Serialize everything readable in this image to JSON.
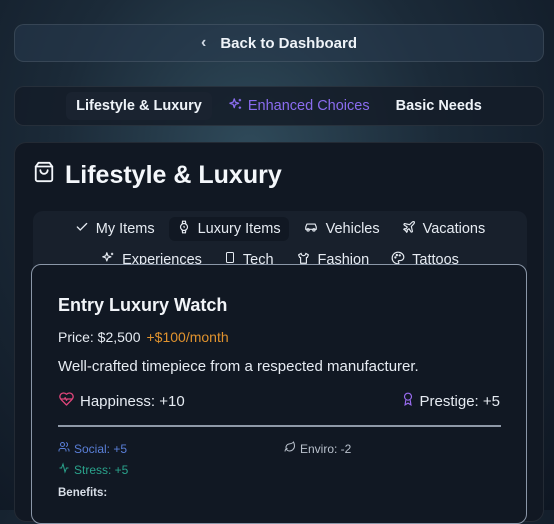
{
  "back_button": {
    "label": "Back to Dashboard"
  },
  "main_tabs": [
    {
      "label": "Lifestyle & Luxury",
      "active": true
    },
    {
      "label": "Enhanced Choices",
      "icon": "sparkles-icon",
      "accent": "#8a6cf0"
    },
    {
      "label": "Basic Needs"
    }
  ],
  "panel": {
    "title": "Lifestyle & Luxury",
    "icon": "shopping-bag-icon"
  },
  "subtabs_row1": [
    {
      "label": "My Items",
      "icon": "check-icon"
    },
    {
      "label": "Luxury Items",
      "icon": "watch-icon",
      "active": true
    },
    {
      "label": "Vehicles",
      "icon": "car-icon"
    },
    {
      "label": "Vacations",
      "icon": "plane-icon"
    }
  ],
  "subtabs_row2": [
    {
      "label": "Experiences",
      "icon": "sparkles-icon"
    },
    {
      "label": "Tech",
      "icon": "smartphone-icon"
    },
    {
      "label": "Fashion",
      "icon": "shirt-icon"
    },
    {
      "label": "Tattoos",
      "icon": "palette-icon"
    }
  ],
  "card": {
    "name": "Entry Luxury Watch",
    "price": "Price: $2,500",
    "monthly": "+$100/month",
    "description": "Well-crafted timepiece from a respected manufacturer.",
    "happiness": "Happiness: +10",
    "prestige": "Prestige: +5",
    "social": "Social: +5",
    "enviro": "Enviro: -2",
    "stress": "Stress: +5",
    "benefits_label": "Benefits:"
  },
  "colors": {
    "accent_purple": "#8a6cf0",
    "orange": "#e0922e",
    "social_blue": "#5a7fd8",
    "stress_teal": "#2aa38c",
    "heart_pink": "#e0457b",
    "prestige_purple": "#9a6cf0"
  }
}
